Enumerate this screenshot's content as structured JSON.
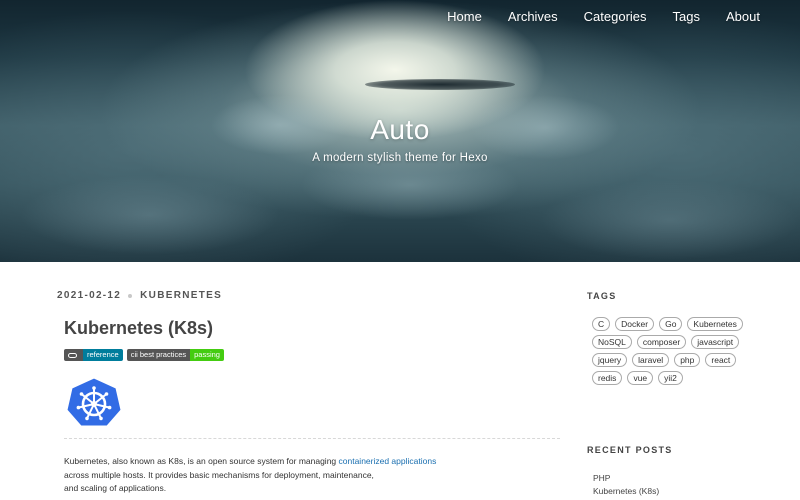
{
  "site": {
    "title": "Auto",
    "subtitle": "A modern stylish theme for Hexo"
  },
  "nav": {
    "items": [
      {
        "label": "Home"
      },
      {
        "label": "Archives"
      },
      {
        "label": "Categories"
      },
      {
        "label": "Tags"
      },
      {
        "label": "About"
      }
    ]
  },
  "post": {
    "date": "2021-02-12",
    "category": "KUBERNETES",
    "title": "Kubernetes (K8s)",
    "badges": [
      {
        "left": "",
        "right": "reference",
        "color": "#007d9c",
        "icon": "link-icon"
      },
      {
        "left": "cii best practices",
        "right": "passing",
        "color": "#44cc11"
      }
    ],
    "logo": "kubernetes-helm-logo",
    "body": {
      "line1_pre": "Kubernetes, also known as K8s, is an open source system for managing ",
      "line1_link": "containerized applications",
      "line2": "across multiple hosts. It provides basic mechanisms for deployment, maintenance,",
      "line3": "and scaling of applications."
    }
  },
  "sidebar": {
    "tags_heading": "TAGS",
    "tags": [
      "C",
      "Docker",
      "Go",
      "Kubernetes",
      "NoSQL",
      "composer",
      "javascript",
      "jquery",
      "laravel",
      "php",
      "react",
      "redis",
      "vue",
      "yii2"
    ],
    "recent_heading": "RECENT POSTS",
    "recent": [
      "PHP",
      "Kubernetes (K8s)"
    ]
  },
  "colors": {
    "link": "#1a6fb0",
    "badge_reference": "#007d9c",
    "badge_passing": "#44cc11",
    "k8s_blue": "#326ce5"
  }
}
